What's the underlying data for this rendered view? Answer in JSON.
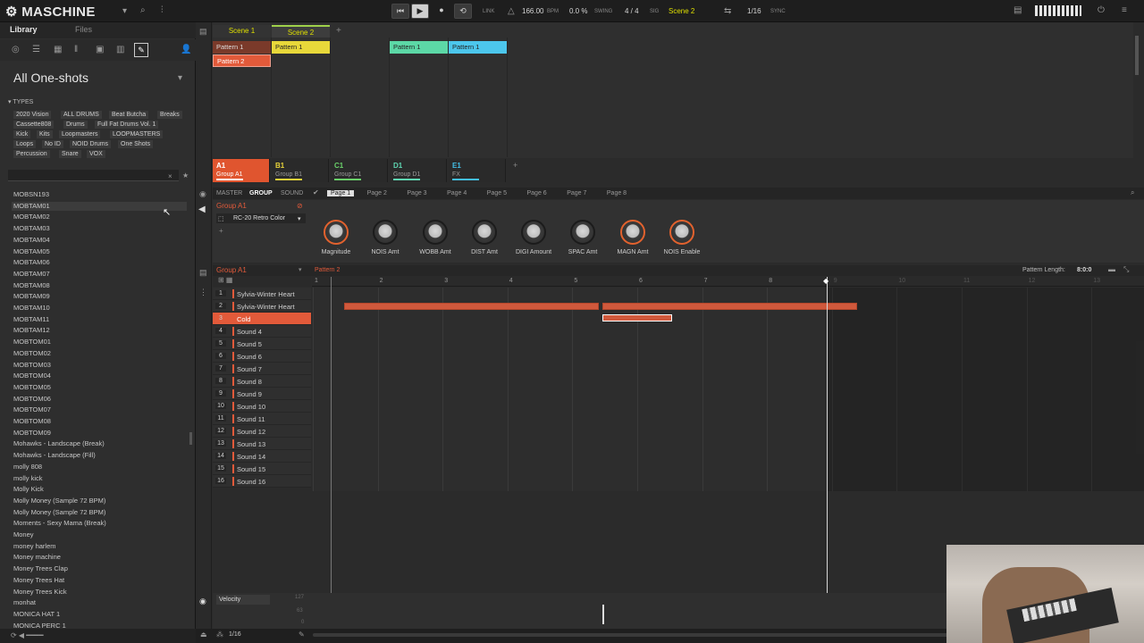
{
  "app": {
    "name": "MASCHINE"
  },
  "transport": {
    "link": "LINK",
    "tempo": "166.00",
    "bpm": "BPM",
    "swing_val": "0.0 %",
    "swing": "SWING",
    "sig_val": "4 / 4",
    "sig": "SIG",
    "scene": "Scene 2",
    "grid": "1/16",
    "sync": "SYNC"
  },
  "library": {
    "tab_library": "Library",
    "tab_files": "Files",
    "category": "All One-shots",
    "types_label": "TYPES",
    "tags": [
      "2020 Vision",
      "ALL DRUMS",
      "Beat Butcha",
      "Breaks",
      "Cassette808",
      "Drums",
      "Full Fat Drums Vol. 1",
      "Kick",
      "Kits",
      "Loopmasters",
      "LOOPMASTERS",
      "Loops",
      "No ID",
      "NOID Drums",
      "One Shots",
      "Percussion",
      "Snare",
      "VOX"
    ],
    "files": [
      "MOBSN193",
      "MOBTAM01",
      "MOBTAM02",
      "MOBTAM03",
      "MOBTAM04",
      "MOBTAM05",
      "MOBTAM06",
      "MOBTAM07",
      "MOBTAM08",
      "MOBTAM09",
      "MOBTAM10",
      "MOBTAM11",
      "MOBTAM12",
      "MOBTOM01",
      "MOBTOM02",
      "MOBTOM03",
      "MOBTOM04",
      "MOBTOM05",
      "MOBTOM06",
      "MOBTOM07",
      "MOBTOM08",
      "MOBTOM09",
      "Mohawks - Landscape (Break)",
      "Mohawks - Landscape (Fill)",
      "molly 808",
      "molly kick",
      "Molly Kick",
      "Molly Money (Sample 72 BPM)",
      "Molly Money (Sample 72 BPM)",
      "Moments - Sexy Mama (Break)",
      "Money",
      "money harlem",
      "Money machine",
      "Money Trees Clap",
      "Money Trees Hat",
      "Money Trees Kick",
      "monhat",
      "MONICA HAT 1",
      "MONICA PERC 1"
    ]
  },
  "scenes": {
    "tabs": [
      "Scene 1",
      "Scene 2"
    ],
    "add": "+"
  },
  "clips": [
    "Pattern 1",
    "Pattern 2",
    "Pattern 1",
    "Pattern 1",
    "Pattern 1"
  ],
  "groups": [
    {
      "letter": "A1",
      "name": "Group A1",
      "color": "#e0552f"
    },
    {
      "letter": "B1",
      "name": "Group B1",
      "color": "#e6d23a"
    },
    {
      "letter": "C1",
      "name": "Group C1",
      "color": "#6ad16a"
    },
    {
      "letter": "D1",
      "name": "Group D1",
      "color": "#5fd6b2"
    },
    {
      "letter": "E1",
      "name": "FX",
      "color": "#43bfe6"
    }
  ],
  "controls": {
    "master": "MASTER",
    "group": "GROUP",
    "sound": "SOUND",
    "pages": [
      "Page 1",
      "Page 2",
      "Page 3",
      "Page 4",
      "Page 5",
      "Page 6",
      "Page 7",
      "Page 8"
    ],
    "group_name": "Group A1",
    "plugin": "RC-20 Retro Color",
    "knobs": [
      "Magnitude",
      "NOIS Amt",
      "WOBB Amt",
      "DIST Amt",
      "DIGI Amount",
      "SPAC Amt",
      "MAGN Amt",
      "NOIS Enable"
    ]
  },
  "pattern": {
    "group": "Group A1",
    "name": "Pattern 2",
    "length_label": "Pattern Length:",
    "length": "8:0:0",
    "ruler": [
      "1",
      "2",
      "3",
      "4",
      "5",
      "6",
      "7",
      "8",
      "9",
      "10",
      "11",
      "12",
      "13"
    ],
    "sounds": [
      "Sylvia-Winter Heart",
      "Sylvia-Winter Heart",
      "Cold",
      "Sound 4",
      "Sound 5",
      "Sound 6",
      "Sound 7",
      "Sound 8",
      "Sound 9",
      "Sound 10",
      "Sound 11",
      "Sound 12",
      "Sound 13",
      "Sound 14",
      "Sound 15",
      "Sound 16"
    ]
  },
  "velocity": {
    "label": "Velocity",
    "v127": "127",
    "v63": "63",
    "v0": "0"
  },
  "bottom": {
    "grid": "1/16"
  }
}
